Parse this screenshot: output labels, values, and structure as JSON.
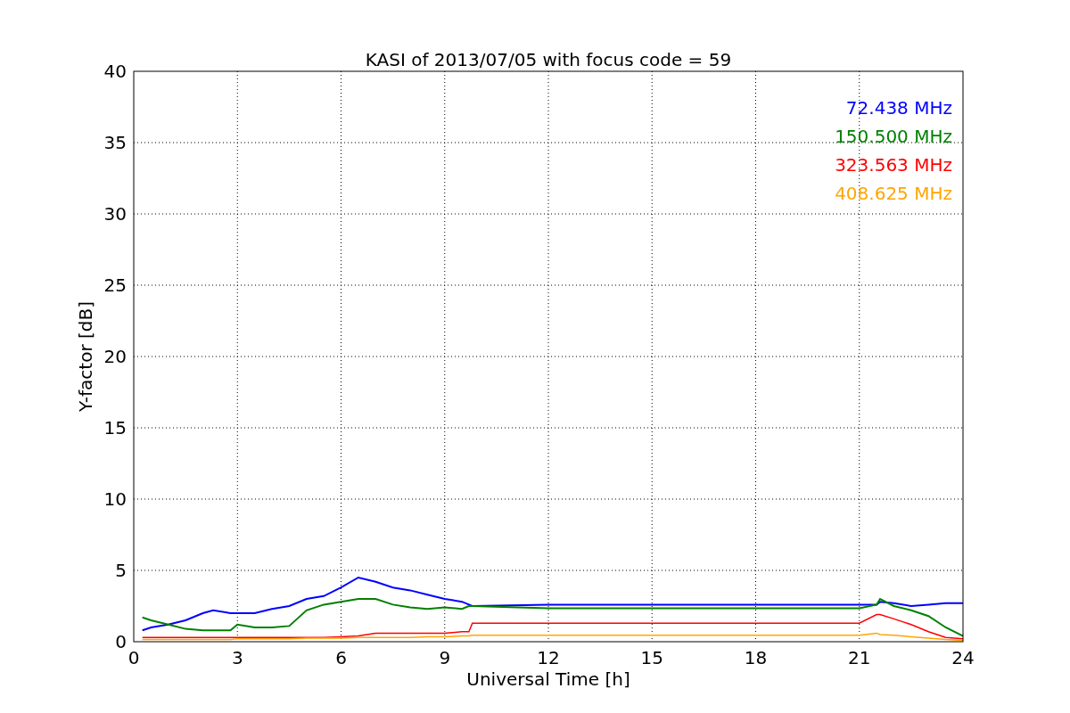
{
  "chart": {
    "chart_data": {
      "type": "line",
      "title": "KASI of 2013/07/05 with focus code = 59",
      "xlabel": "Universal Time [h]",
      "ylabel": "Y-factor [dB]",
      "xlim": [
        0,
        24
      ],
      "ylim": [
        0,
        40
      ],
      "xticks": [
        0,
        3,
        6,
        9,
        12,
        15,
        18,
        21,
        24
      ],
      "yticks": [
        0,
        5,
        10,
        15,
        20,
        25,
        30,
        35,
        40
      ],
      "grid": true,
      "x": [
        0.25,
        0.5,
        1,
        1.5,
        2,
        2.3,
        2.8,
        3,
        3.5,
        4,
        4.5,
        5,
        5.5,
        6,
        6.5,
        7,
        7.5,
        8,
        8.5,
        9,
        9.5,
        9.7,
        9.8,
        12,
        15,
        18,
        21,
        21.5,
        21.6,
        22,
        22.5,
        23,
        23.5,
        24
      ],
      "series": [
        {
          "name": "72.438 MHz",
          "color": "#0000ff",
          "values": [
            0.8,
            1,
            1.2,
            1.5,
            2,
            2.2,
            2,
            2,
            2,
            2.3,
            2.5,
            3,
            3.2,
            3.8,
            4.5,
            4.2,
            3.8,
            3.6,
            3.3,
            3,
            2.8,
            2.6,
            2.5,
            2.6,
            2.6,
            2.6,
            2.6,
            2.6,
            2.8,
            2.7,
            2.5,
            2.6,
            2.7,
            2.7
          ]
        },
        {
          "name": "150.500 MHz",
          "color": "#008000",
          "values": [
            1.7,
            1.5,
            1.2,
            0.9,
            0.8,
            0.8,
            0.8,
            1.2,
            1,
            1,
            1.1,
            2.2,
            2.6,
            2.8,
            3,
            3,
            2.6,
            2.4,
            2.3,
            2.4,
            2.3,
            2.5,
            2.5,
            2.35,
            2.35,
            2.35,
            2.35,
            2.6,
            3,
            2.5,
            2.2,
            1.8,
            1,
            0.4
          ]
        },
        {
          "name": "323.563 MHz",
          "color": "#ff0000",
          "values": [
            0.3,
            0.3,
            0.3,
            0.3,
            0.3,
            0.3,
            0.3,
            0.3,
            0.3,
            0.3,
            0.3,
            0.3,
            0.3,
            0.35,
            0.4,
            0.6,
            0.6,
            0.6,
            0.6,
            0.6,
            0.7,
            0.7,
            1.3,
            1.3,
            1.3,
            1.3,
            1.3,
            1.9,
            1.9,
            1.6,
            1.2,
            0.7,
            0.3,
            0.2
          ]
        },
        {
          "name": "408.625 MHz",
          "color": "#ffa500",
          "values": [
            0.15,
            0.15,
            0.15,
            0.15,
            0.15,
            0.15,
            0.15,
            0.2,
            0.2,
            0.2,
            0.2,
            0.25,
            0.25,
            0.25,
            0.3,
            0.3,
            0.3,
            0.3,
            0.35,
            0.35,
            0.4,
            0.4,
            0.45,
            0.45,
            0.45,
            0.45,
            0.45,
            0.6,
            0.5,
            0.45,
            0.35,
            0.25,
            0.15,
            0.1
          ]
        }
      ]
    }
  }
}
